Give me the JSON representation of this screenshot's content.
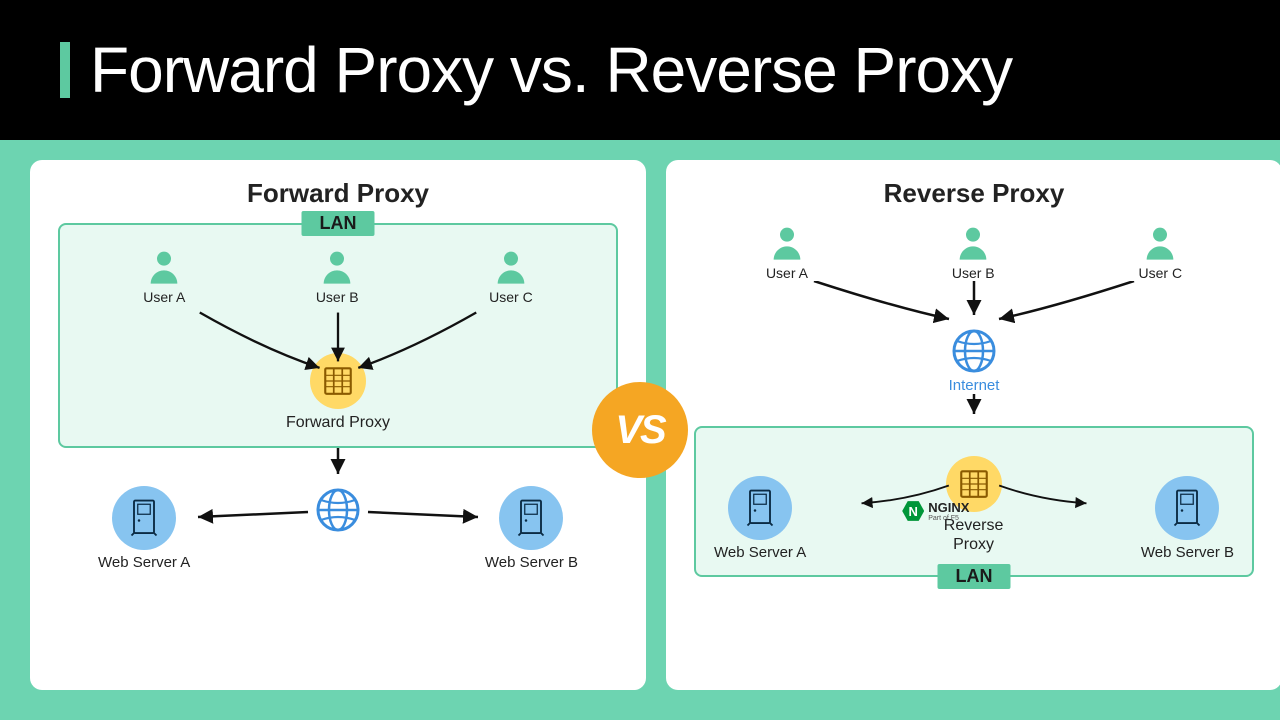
{
  "header": {
    "title": "Forward Proxy vs. Reverse Proxy"
  },
  "vs": {
    "label": "VS"
  },
  "left": {
    "title": "Forward Proxy",
    "lan_label": "LAN",
    "users": [
      "User A",
      "User B",
      "User C"
    ],
    "proxy_label": "Forward Proxy",
    "servers": [
      "Web Server A",
      "Web Server B"
    ]
  },
  "right": {
    "title": "Reverse Proxy",
    "users": [
      "User A",
      "User B",
      "User C"
    ],
    "internet_label": "Internet",
    "lan_label": "LAN",
    "proxy_label": "Reverse\nProxy",
    "servers": [
      "Web Server A",
      "Web Server B"
    ],
    "nginx": {
      "name": "NGINX",
      "sub": "Part of F5",
      "letter": "N"
    }
  }
}
